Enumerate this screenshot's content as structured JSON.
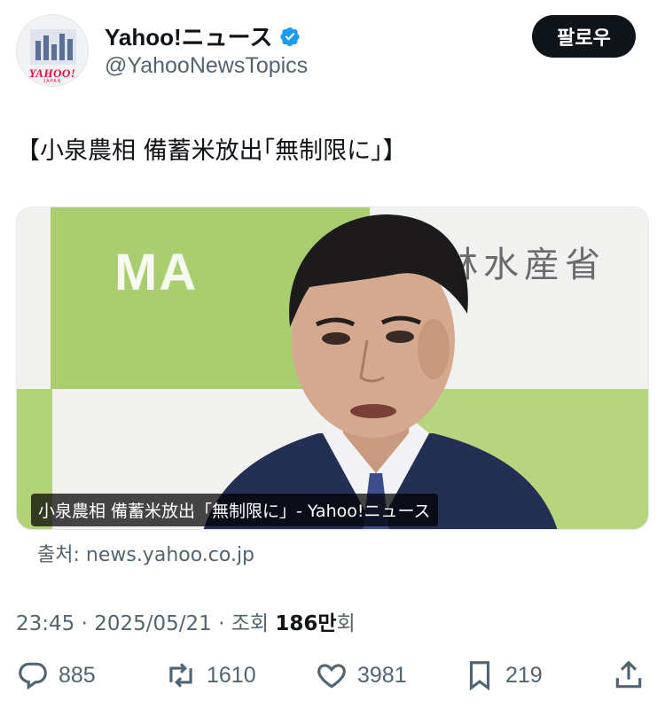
{
  "account": {
    "display_name": "Yahoo!ニュース",
    "handle": "@YahooNewsTopics",
    "avatar_logo": "YAHOO!",
    "avatar_sub": "JAPAN",
    "verified_icon": "verified-badge-icon"
  },
  "follow_label": "팔로우",
  "tweet_text": "【小泉農相 備蓄米放出｢無制限に｣】",
  "card": {
    "sign_text": "農林水産省",
    "bg_letters": "MA",
    "caption": "小泉農相 備蓄米放出「無制限に」- Yahoo!ニュース",
    "source": "출처: news.yahoo.co.jp"
  },
  "meta": {
    "time": "23:45",
    "date": "2025/05/21",
    "views_prefix": "조회",
    "views_count": "186만",
    "views_suffix": "회"
  },
  "actions": {
    "replies": "885",
    "reposts": "1610",
    "likes": "3981",
    "bookmarks": "219"
  },
  "colors": {
    "text": "#0f1419",
    "secondary": "#536471",
    "verified": "#1d9bf0",
    "follow_bg": "#0f1419"
  }
}
